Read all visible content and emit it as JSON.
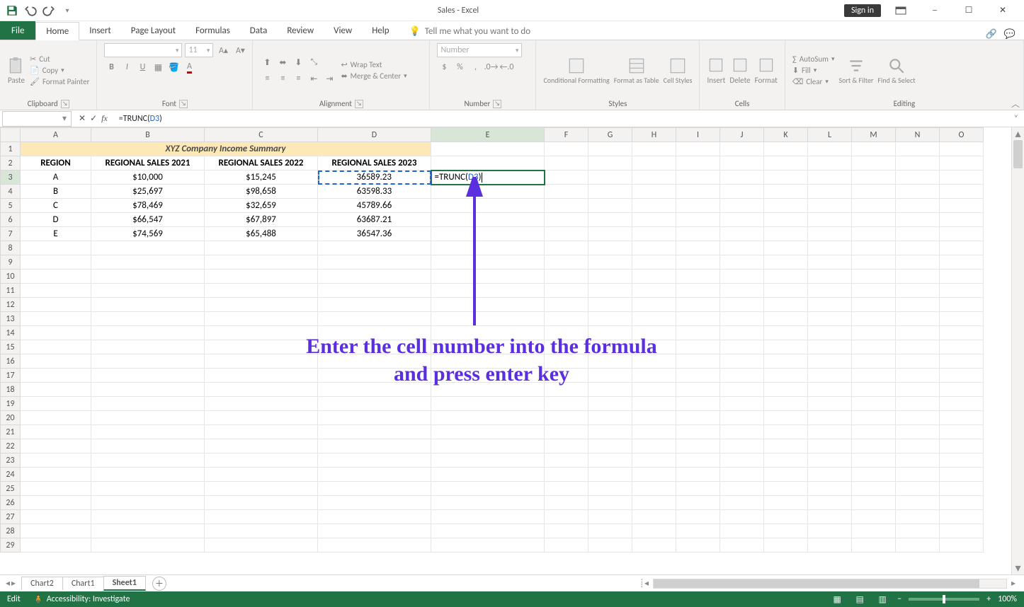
{
  "title": "Sales - Excel",
  "signin": "Sign in",
  "tabs": {
    "file": "File",
    "home": "Home",
    "insert": "Insert",
    "pagelayout": "Page Layout",
    "formulas": "Formulas",
    "data": "Data",
    "review": "Review",
    "view": "View",
    "help": "Help",
    "tellme": "Tell me what you want to do"
  },
  "ribbon": {
    "clipboard": {
      "label": "Clipboard",
      "paste": "Paste",
      "cut": "Cut",
      "copy": "Copy",
      "fmtpainter": "Format Painter"
    },
    "font": {
      "label": "Font",
      "name": "",
      "size": "11"
    },
    "alignment": {
      "label": "Alignment",
      "wrap": "Wrap Text",
      "merge": "Merge & Center"
    },
    "number": {
      "label": "Number",
      "fmt": "Number"
    },
    "styles": {
      "label": "Styles",
      "cond": "Conditional Formatting",
      "table": "Format as Table",
      "cell": "Cell Styles"
    },
    "cells": {
      "label": "Cells",
      "insert": "Insert",
      "delete": "Delete",
      "format": "Format"
    },
    "editing": {
      "label": "Editing",
      "autosum": "AutoSum",
      "fill": "Fill",
      "clear": "Clear",
      "sort": "Sort & Filter",
      "find": "Find & Select"
    }
  },
  "namebox": "",
  "formula_plain": "=TRUNC(",
  "formula_ref": "D3",
  "formula_tail": ")",
  "columns": [
    "A",
    "B",
    "C",
    "D",
    "E",
    "F",
    "G",
    "H",
    "I",
    "J",
    "K",
    "L",
    "M",
    "N",
    "O"
  ],
  "active_col": "E",
  "active_row": 3,
  "merged_title": "XYZ Company Income Summary",
  "headers": {
    "A": "REGION",
    "B": "REGIONAL SALES 2021",
    "C": "REGIONAL SALES 2022",
    "D": "REGIONAL SALES 2023"
  },
  "rows": [
    {
      "A": "A",
      "B": "$10,000",
      "C": "$15,245",
      "D": "36589.23"
    },
    {
      "A": "B",
      "B": "$25,697",
      "C": "$98,658",
      "D": "63598.33"
    },
    {
      "A": "C",
      "B": "$78,469",
      "C": "$32,659",
      "D": "45789.66"
    },
    {
      "A": "D",
      "B": "$66,547",
      "C": "$67,897",
      "D": "63687.21"
    },
    {
      "A": "E",
      "B": "$74,569",
      "C": "$65,488",
      "D": "36547.36"
    }
  ],
  "editing_cell_prefix": "=TRUNC(",
  "editing_cell_ref": "D3",
  "editing_cell_suffix": ")",
  "annotation": "Enter the cell number into the formula and press enter key",
  "sheets": {
    "chart2": "Chart2",
    "chart1": "Chart1",
    "sheet1": "Sheet1"
  },
  "status": {
    "mode": "Edit",
    "access": "Accessibility: Investigate",
    "zoom": "100%"
  }
}
